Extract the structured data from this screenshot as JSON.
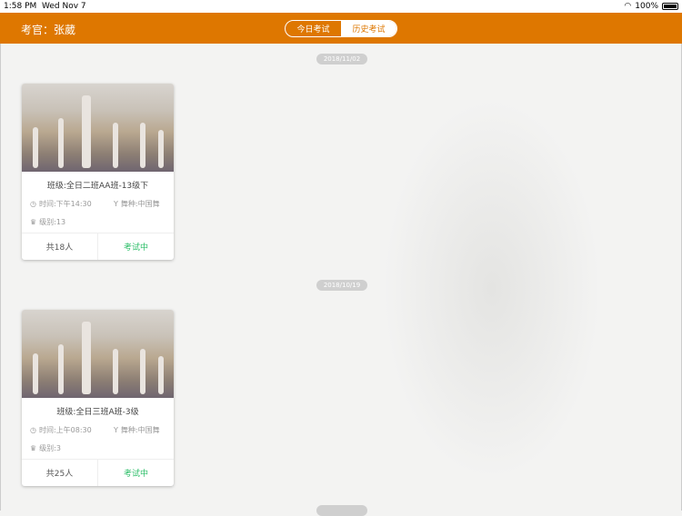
{
  "status_bar": {
    "time": "1:58 PM",
    "date": "Wed Nov 7",
    "battery": "100%"
  },
  "header": {
    "title": "考官：张葳",
    "tabs": [
      {
        "label": "今日考试",
        "active": false
      },
      {
        "label": "历史考试",
        "active": true
      }
    ]
  },
  "colors": {
    "accent": "#de7700",
    "status": "#2fbf6a"
  },
  "groups": [
    {
      "date": "2018/11/02",
      "card": {
        "class_name": "班级:全日二班AA班-13级下",
        "time": "时间:下午14:30",
        "dance": "舞种:中国舞",
        "level": "级别:13",
        "count": "共18人",
        "status": "考试中"
      }
    },
    {
      "date": "2018/10/19",
      "card": {
        "class_name": "班级:全日三班A班-3级",
        "time": "时间:上午08:30",
        "dance": "舞种:中国舞",
        "level": "级别:3",
        "count": "共25人",
        "status": "考试中"
      }
    }
  ]
}
